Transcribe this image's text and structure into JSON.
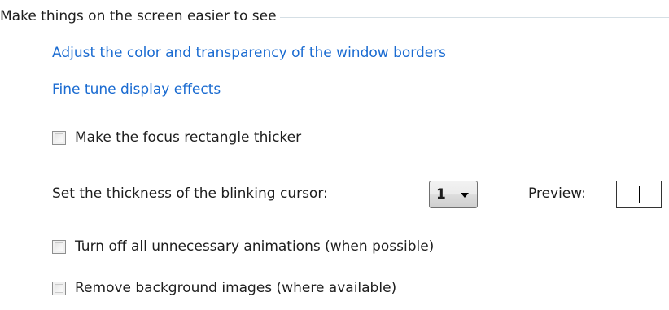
{
  "group": {
    "title": "Make things on the screen easier to see"
  },
  "links": {
    "window_borders": "Adjust the color and transparency of the window borders",
    "display_effects": "Fine tune display effects"
  },
  "options": {
    "focus_rectangle": {
      "label": "Make the focus rectangle thicker",
      "checked": false
    },
    "animations": {
      "label": "Turn off all unnecessary animations (when possible)",
      "checked": false
    },
    "background_images": {
      "label": "Remove background images (where available)",
      "checked": false
    }
  },
  "cursor": {
    "label": "Set the thickness of the blinking cursor:",
    "selected_value": "1",
    "preview_label": "Preview:"
  },
  "colors": {
    "link": "#1a6bd1",
    "text": "#1e1e1e",
    "rule": "#d5dfe5"
  },
  "icons": {
    "dropdown_arrow": "chevron-down-icon",
    "preview_caret": "text-cursor-icon"
  }
}
